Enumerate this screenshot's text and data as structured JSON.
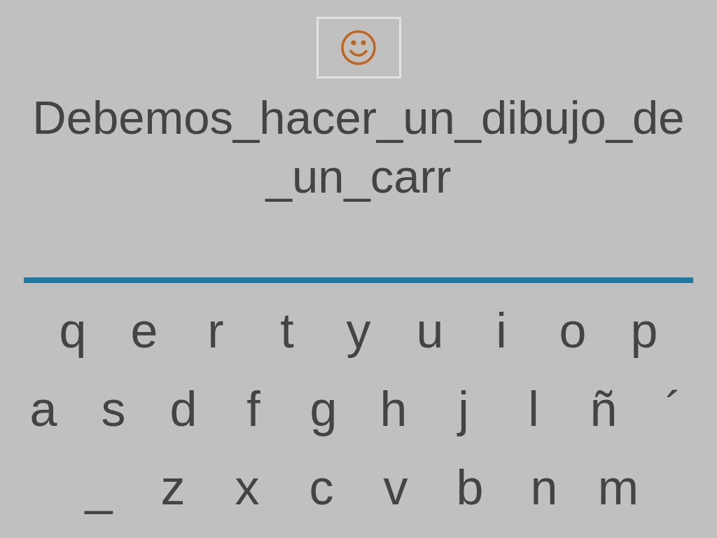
{
  "phrase_lines": [
    "Debemos_hacer_un_dibujo_de",
    "_un_carr"
  ],
  "keyboard_rows": [
    [
      "q",
      "e",
      "r",
      "t",
      "y",
      "u",
      "i",
      "o",
      "p"
    ],
    [
      "a",
      "s",
      "d",
      "f",
      "g",
      "h",
      "j",
      "l",
      "ñ",
      "´"
    ],
    [
      "_",
      "z",
      "x",
      "c",
      "v",
      "b",
      "n",
      "m"
    ]
  ]
}
